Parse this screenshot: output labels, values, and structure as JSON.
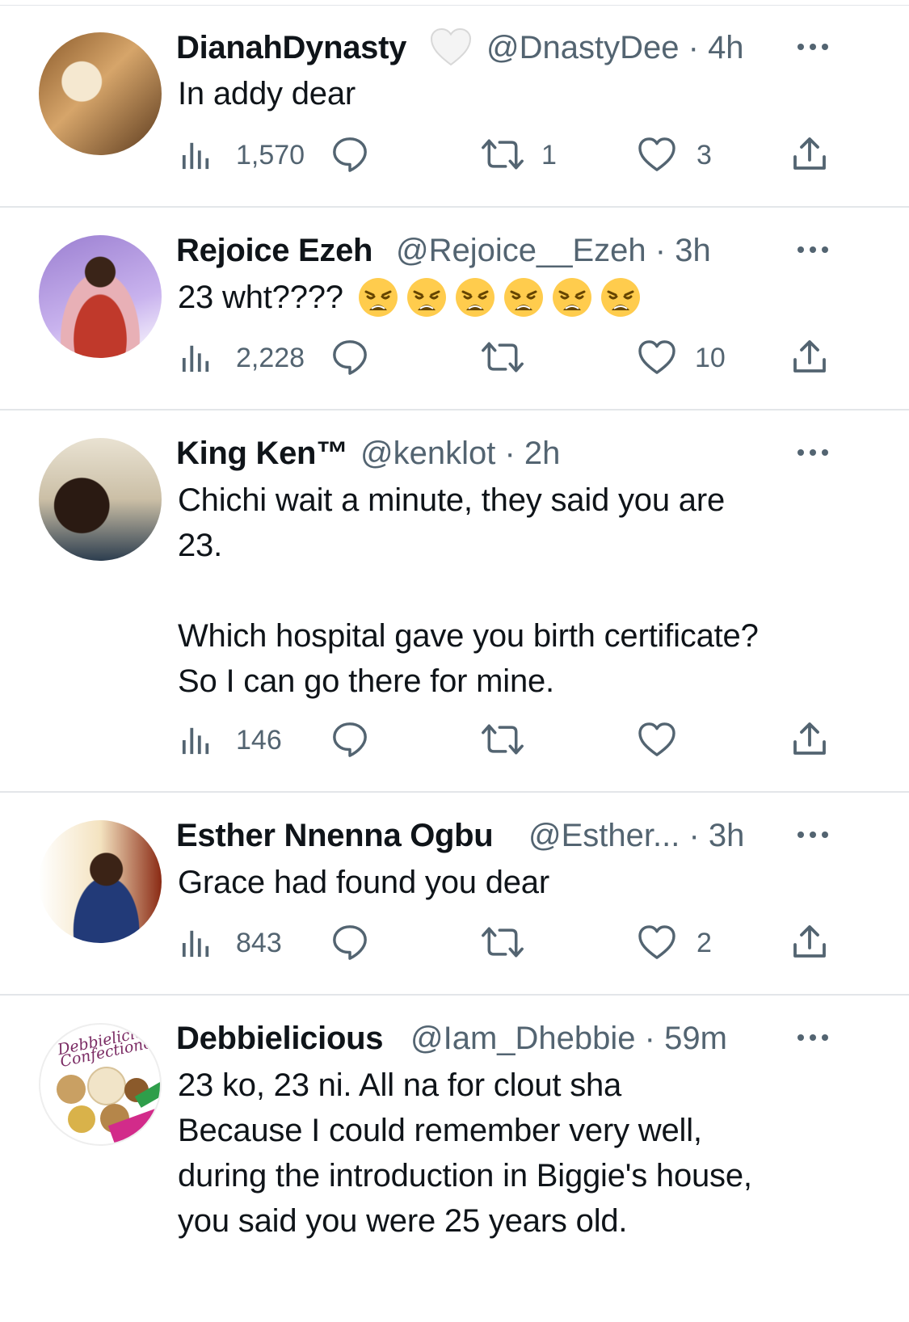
{
  "tweets": [
    {
      "name": "DianahDynasty",
      "handle": "@DnastyDee",
      "sep": "·",
      "time": "4h",
      "text": "In addy dear",
      "views": "1,570",
      "replies": "",
      "retweets": "1",
      "likes": "3"
    },
    {
      "name": "Rejoice Ezeh",
      "handle": "@Rejoice__Ezeh",
      "sep": "·",
      "time": "3h",
      "text": "23 wht????",
      "emoji_count_shown": 6,
      "views": "2,228",
      "replies": "",
      "retweets": "",
      "likes": "10"
    },
    {
      "name": "King Ken™",
      "handle": "@kenklot",
      "sep": "·",
      "time": "2h",
      "text": "Chichi wait a minute, they said you are\n23.\n\nWhich hospital gave you birth certificate?\nSo I can go there for mine.",
      "views": "146",
      "replies": "",
      "retweets": "",
      "likes": ""
    },
    {
      "name": "Esther Nnenna Ogbu",
      "handle": "@Esther...",
      "sep": "·",
      "time": "3h",
      "text": "Grace had found you dear",
      "views": "843",
      "replies": "",
      "retweets": "",
      "likes": "2"
    },
    {
      "name": "Debbielicious",
      "handle": "@Iam_Dhebbie",
      "sep": "·",
      "time": "59m",
      "text": "23 ko, 23 ni. All na for clout sha\nBecause I could remember very well,\nduring the introduction in Biggie's house,\nyou said you were 25 years old.",
      "avatar_logo_text": "Debbielicious Confectionery"
    }
  ],
  "icons": {
    "views": "bar-chart-icon",
    "reply": "speech-bubble-icon",
    "retweet": "retweet-icon",
    "like": "heart-icon",
    "share": "share-icon",
    "more": "more-dots-icon"
  },
  "colors": {
    "text": "#0f1419",
    "secondary": "#536471",
    "divider": "#e3e6e9"
  }
}
